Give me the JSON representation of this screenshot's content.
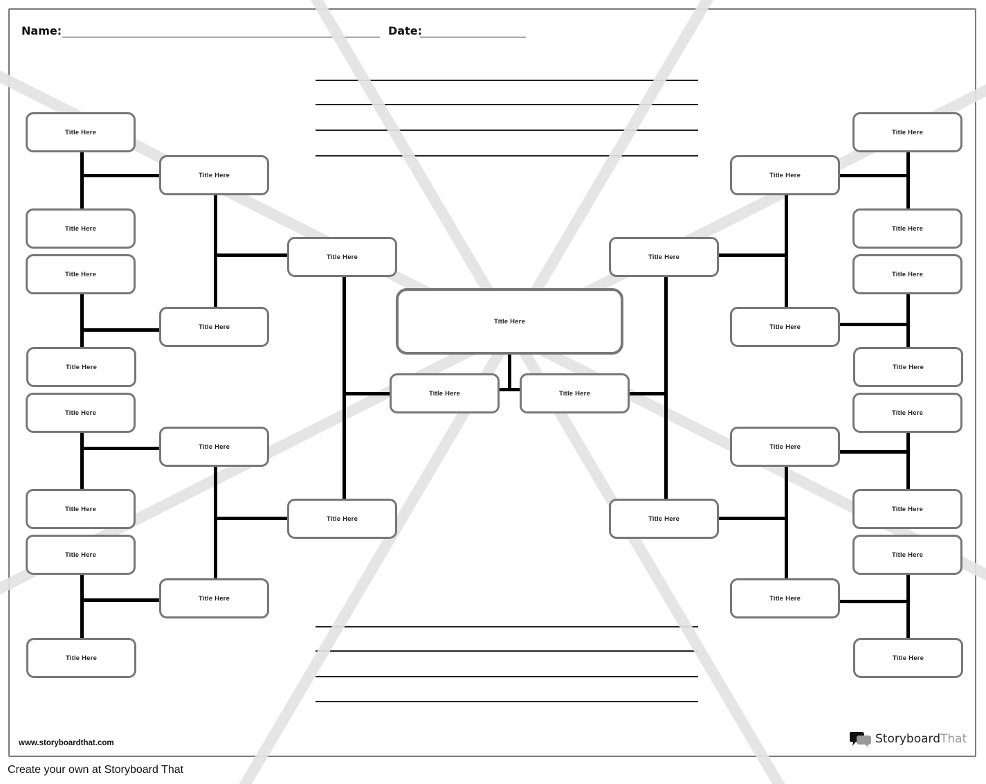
{
  "header": {
    "name_label": "Name:",
    "date_label": "Date:"
  },
  "node_label": "Title Here",
  "center": {
    "label": "Title Here"
  },
  "nodes": {
    "left_outer": [
      "Title Here",
      "Title Here",
      "Title Here",
      "Title Here",
      "Title Here",
      "Title Here",
      "Title Here",
      "Title Here"
    ],
    "left_mid": [
      "Title Here",
      "Title Here",
      "Title Here",
      "Title Here"
    ],
    "left_inner": [
      "Title Here",
      "Title Here"
    ],
    "center_children": [
      "Title Here",
      "Title Here"
    ],
    "right_inner": [
      "Title Here",
      "Title Here"
    ],
    "right_mid": [
      "Title Here",
      "Title Here",
      "Title Here",
      "Title Here"
    ],
    "right_outer": [
      "Title Here",
      "Title Here",
      "Title Here",
      "Title Here",
      "Title Here",
      "Title Here",
      "Title Here",
      "Title Here"
    ]
  },
  "footer": {
    "url": "www.storyboardthat.com",
    "cta": "Create your own at Storyboard That",
    "brand_part1": "Storyboard",
    "brand_part2": "That"
  },
  "colors": {
    "box_border": "#777777",
    "connector": "#000000",
    "watermark": "#e6e6e6"
  }
}
